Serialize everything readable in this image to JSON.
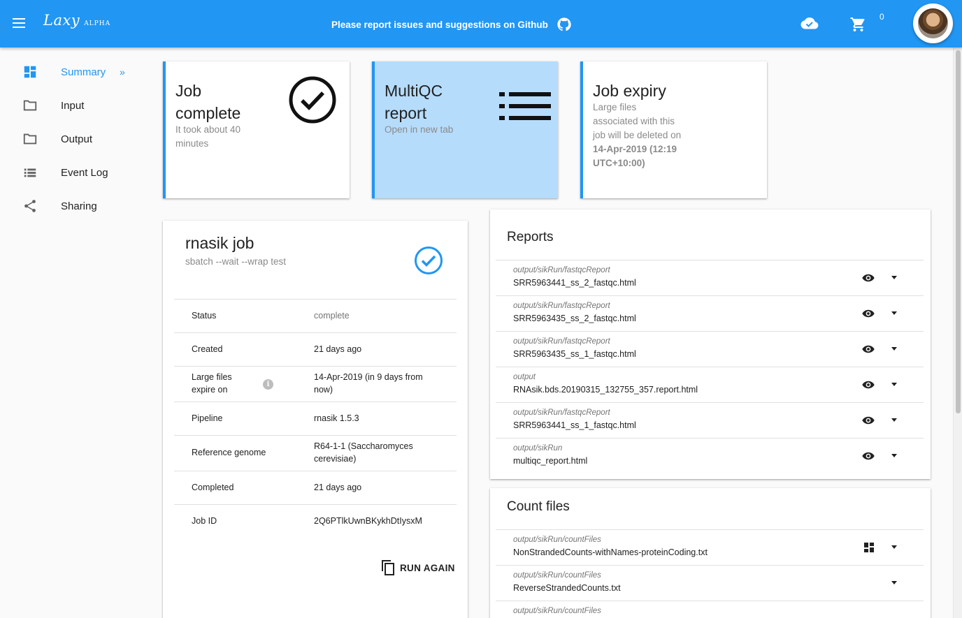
{
  "app": {
    "logo": "Laxy",
    "badge": "ALPHA"
  },
  "header": {
    "banner": "Please report issues and suggestions on Github",
    "cart_count": "0"
  },
  "sidebar": {
    "items": [
      {
        "label": "Summary",
        "icon": "dashboard-icon",
        "active": true,
        "chevron": "»"
      },
      {
        "label": "Input",
        "icon": "folder-icon"
      },
      {
        "label": "Output",
        "icon": "folder-icon"
      },
      {
        "label": "Event Log",
        "icon": "list-icon"
      },
      {
        "label": "Sharing",
        "icon": "share-icon"
      }
    ]
  },
  "tiles": {
    "complete": {
      "title_line1": "Job",
      "title_line2": "complete",
      "sub_line1": "It took about 40",
      "sub_line2": "minutes",
      "icon": "check-circle-icon"
    },
    "multiqc": {
      "title_line1": "MultiQC",
      "title_line2": "report",
      "sub": "Open in new tab",
      "icon": "list-icon",
      "bg": "#b6dcfb"
    },
    "expiry": {
      "title": "Job expiry",
      "sub_line1": "Large files",
      "sub_line2": "associated with this",
      "sub_line3": "job will be deleted on",
      "date_line1": "14-Apr-2019 (12:19",
      "date_line2": "UTC+10:00)"
    }
  },
  "job": {
    "title": "rnasik job",
    "subtitle": "sbatch --wait --wrap test",
    "rows": [
      {
        "key": "Status",
        "value": "complete"
      },
      {
        "key": "Created",
        "value": "21 days ago"
      },
      {
        "key_line1": "Large files",
        "key_line2": "expire on",
        "value_line1": "14-Apr-2019 (in 9 days from",
        "value_line2": "now)"
      },
      {
        "key": "Pipeline",
        "value": "rnasik 1.5.3"
      },
      {
        "key": "Reference genome",
        "value_line1": "R64-1-1 (Saccharomyces",
        "value_line2": "cerevisiae)"
      },
      {
        "key": "Completed",
        "value": "21 days ago"
      },
      {
        "key": "Job ID",
        "value": "2Q6PTlkUwnBKykhDtIysxM"
      }
    ],
    "run_again": "RUN AGAIN"
  },
  "reports": {
    "title": "Reports",
    "files": [
      {
        "path": "output/sikRun/fastqcReport",
        "name": "SRR5963441_ss_2_fastqc.html"
      },
      {
        "path": "output/sikRun/fastqcReport",
        "name": "SRR5963435_ss_2_fastqc.html"
      },
      {
        "path": "output/sikRun/fastqcReport",
        "name": "SRR5963435_ss_1_fastqc.html"
      },
      {
        "path": "output",
        "name": "RNAsik.bds.20190315_132755_357.report.html"
      },
      {
        "path": "output/sikRun/fastqcReport",
        "name": "SRR5963441_ss_1_fastqc.html"
      },
      {
        "path": "output/sikRun",
        "name": "multiqc_report.html"
      }
    ]
  },
  "count_files": {
    "title": "Count files",
    "files": [
      {
        "path": "output/sikRun/countFiles",
        "name": "NonStrandedCounts-withNames-proteinCoding.txt"
      },
      {
        "path": "output/sikRun/countFiles",
        "name": "ReverseStrandedCounts.txt"
      },
      {
        "path": "output/sikRun/countFiles",
        "name": ""
      }
    ]
  },
  "colors": {
    "primary": "#2196f3",
    "tile_highlight": "#b6dcfb"
  }
}
